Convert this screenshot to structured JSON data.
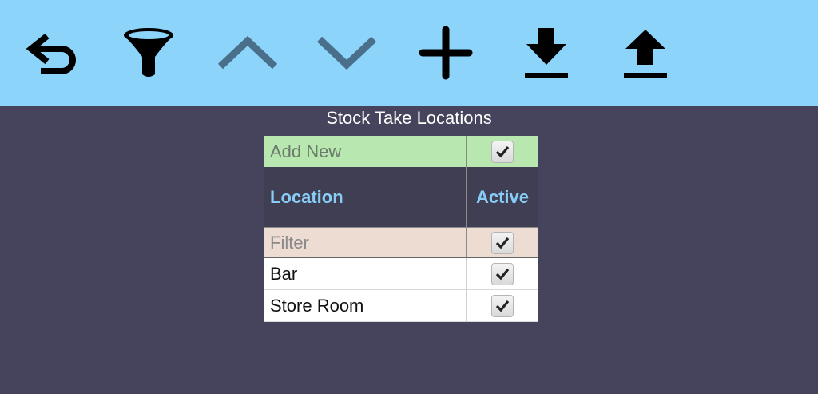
{
  "toolbar": {
    "buttons": [
      {
        "name": "undo-icon"
      },
      {
        "name": "filter-icon"
      },
      {
        "name": "chevron-up-icon"
      },
      {
        "name": "chevron-down-icon"
      },
      {
        "name": "plus-icon"
      },
      {
        "name": "download-icon"
      },
      {
        "name": "upload-icon"
      }
    ]
  },
  "page": {
    "title": "Stock Take Locations"
  },
  "table": {
    "add_row": {
      "placeholder": "Add New",
      "checked": true
    },
    "headers": {
      "location": "Location",
      "active": "Active"
    },
    "filter_row": {
      "placeholder": "Filter",
      "checked": true
    },
    "rows": [
      {
        "location": "Bar",
        "active": true
      },
      {
        "location": "Store Room",
        "active": true
      }
    ]
  },
  "colors": {
    "toolbar_bg": "#8dd4fb",
    "page_bg": "#46445c",
    "add_row_bg": "#b8e8b0",
    "header_bg": "#3f3e52",
    "header_text": "#87cdf6",
    "filter_row_bg": "#eddcd2"
  }
}
